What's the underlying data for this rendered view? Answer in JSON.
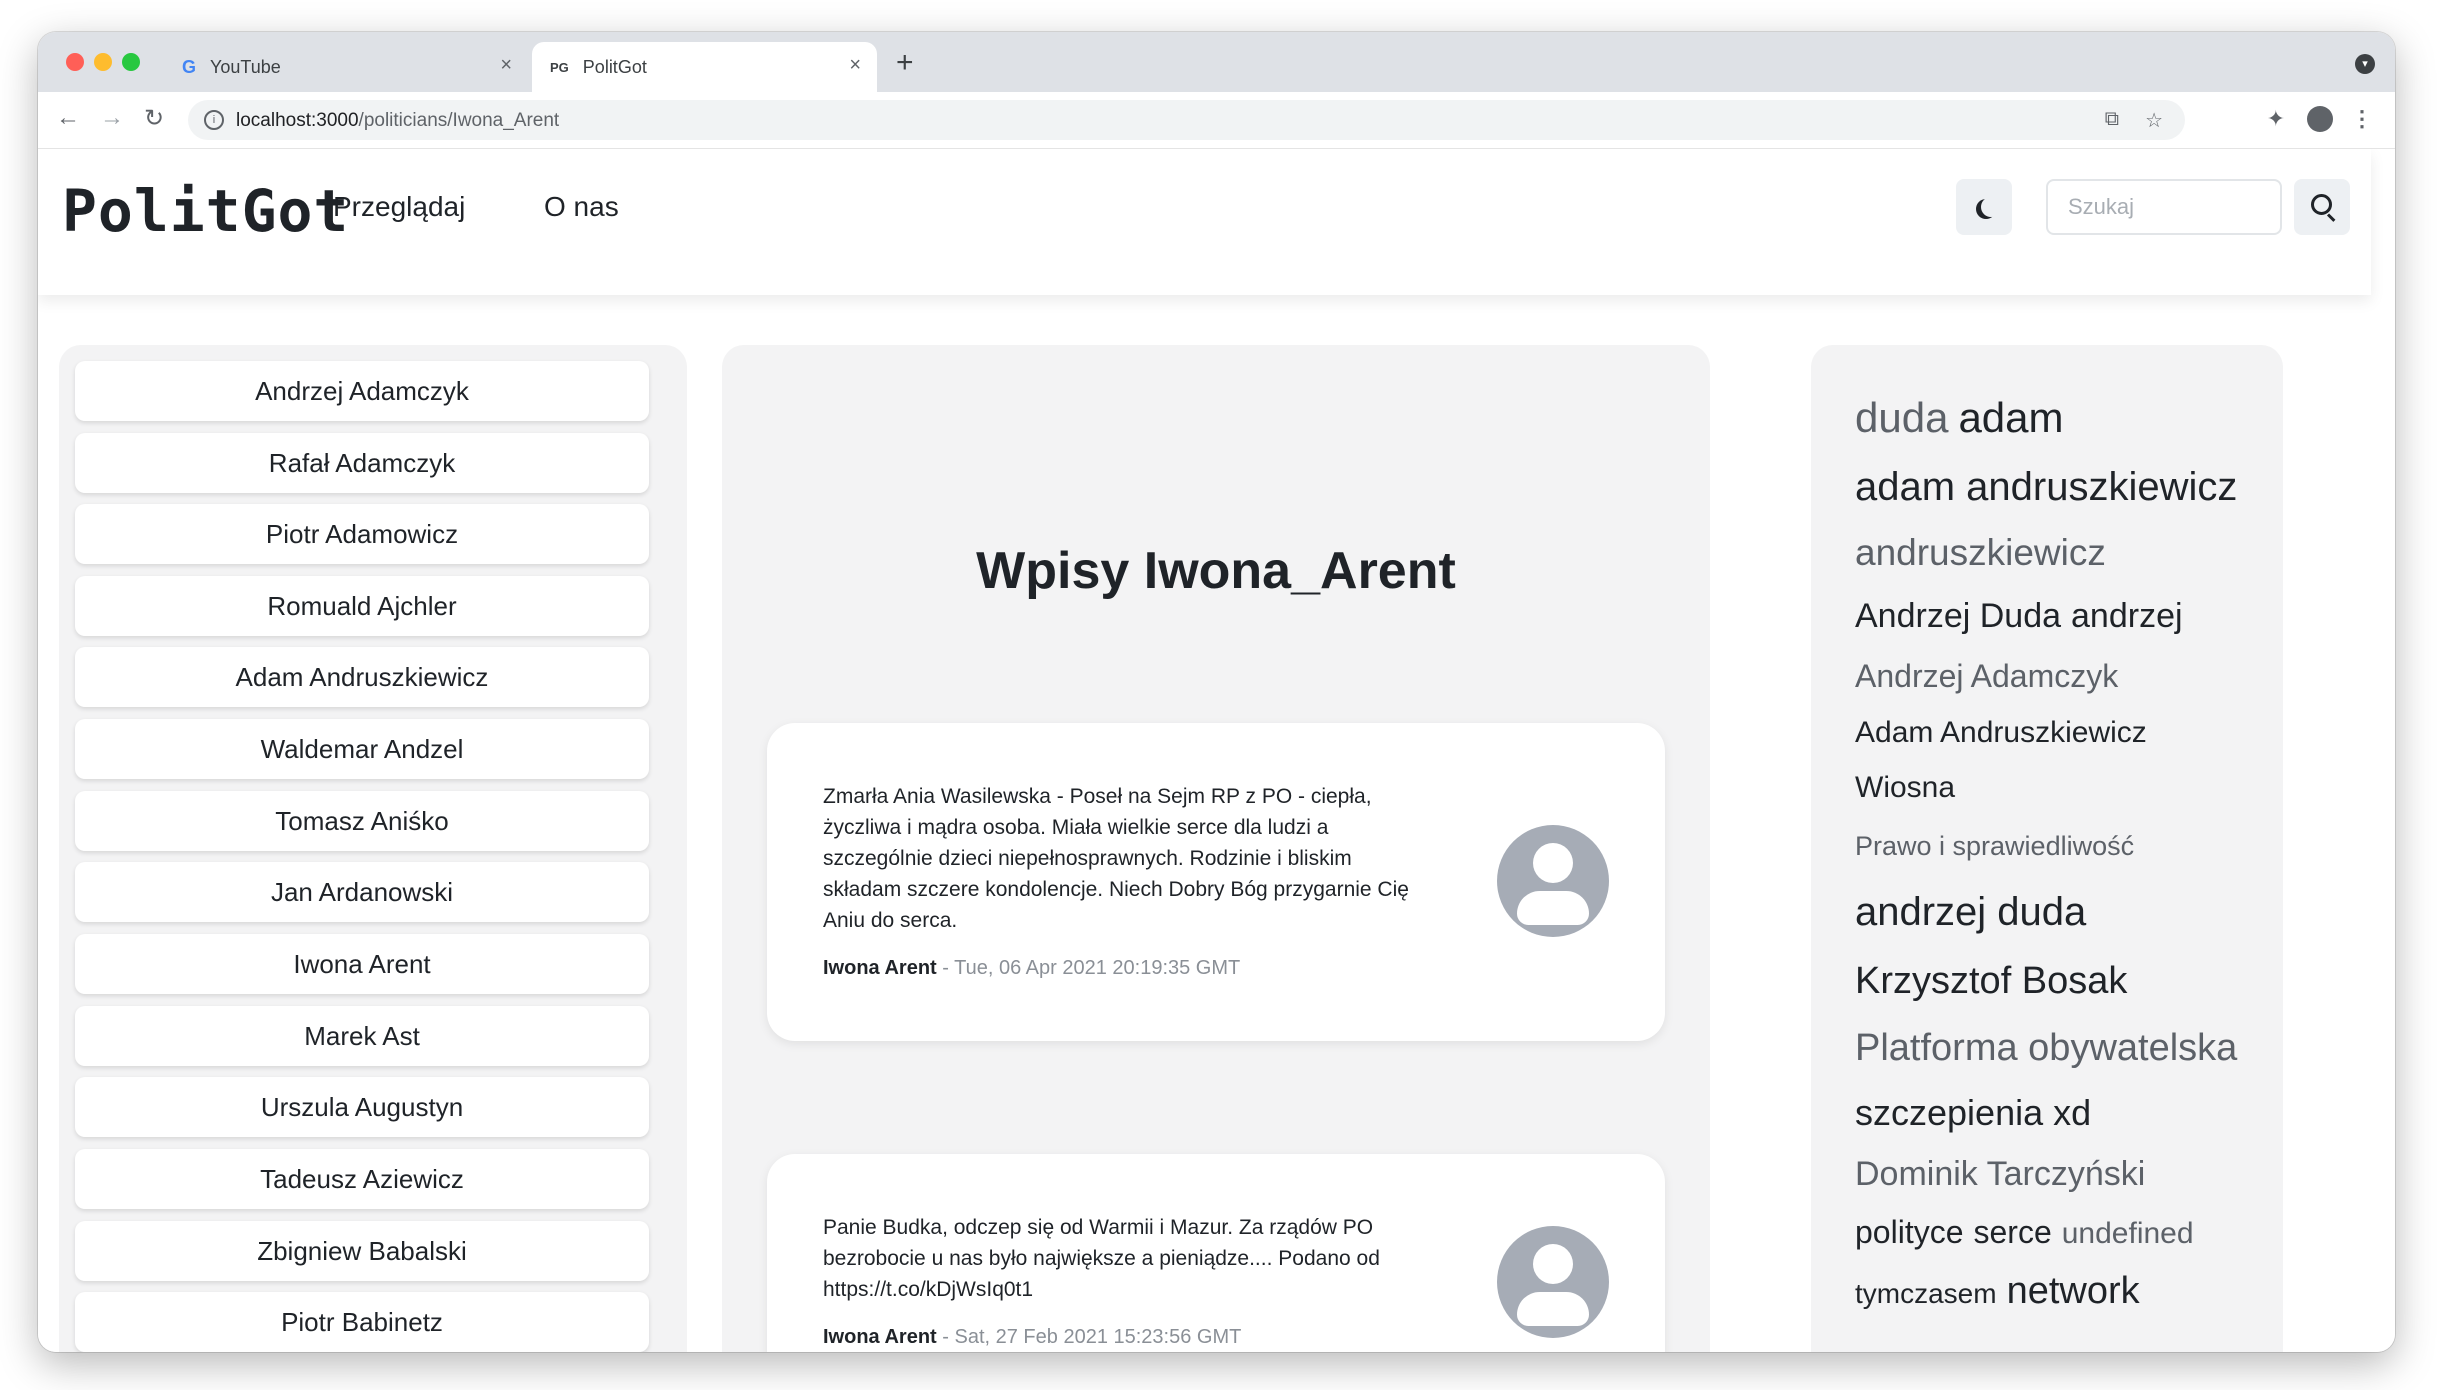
{
  "browser": {
    "tabs": [
      {
        "favicon": "G",
        "title": "YouTube",
        "close": "×"
      },
      {
        "favicon": "PG",
        "title": "PolitGot",
        "close": "×"
      }
    ],
    "new_tab": "+",
    "url_host": "localhost:3000",
    "url_path": "/politicians/Iwona_Arent",
    "icons": [
      "back-icon",
      "forward-icon",
      "reload-icon",
      "translate-icon",
      "star-icon",
      "extensions-icon",
      "profile-icon",
      "menu-icon"
    ]
  },
  "navbar": {
    "brand": "PolitGot",
    "links": [
      "Przeglądaj",
      "O nas"
    ],
    "search_placeholder": "Szukaj"
  },
  "politicians": [
    "Andrzej Adamczyk",
    "Rafał Adamczyk",
    "Piotr Adamowicz",
    "Romuald Ajchler",
    "Adam Andruszkiewicz",
    "Waldemar Andzel",
    "Tomasz Aniśko",
    "Jan Ardanowski",
    "Iwona Arent",
    "Marek Ast",
    "Urszula Augustyn",
    "Tadeusz Aziewicz",
    "Zbigniew Babalski",
    "Piotr Babinetz"
  ],
  "main": {
    "title": "Wpisy Iwona_Arent",
    "posts": [
      {
        "text": "Zmarła Ania Wasilewska - Poseł na Sejm RP z PO - ciepła, życzliwa i mądra osoba. Miała wielkie serce dla ludzi a szczególnie dzieci niepełnosprawnych. Rodzinie i bliskim składam szczere kondolencje. Niech Dobry Bóg przygarnie Cię Aniu do serca.",
        "author": "Iwona Arent",
        "date": "- Tue, 06 Apr 2021 20:19:35 GMT"
      },
      {
        "text": "Panie Budka, odczep się od Warmii i Mazur. Za rządów PO bezrobocie u nas było największe a pieniądze.... Podano od https://t.co/kDjWsIq0t1",
        "author": "Iwona Arent",
        "date": "- Sat, 27 Feb 2021 15:23:56 GMT"
      }
    ]
  },
  "tag_cloud": [
    [
      {
        "text": "duda",
        "weight": 3,
        "size": 42
      },
      {
        "text": "adam",
        "weight": 4,
        "size": 42
      }
    ],
    [
      {
        "text": "adam andruszkiewicz",
        "weight": 4,
        "size": 40
      }
    ],
    [
      {
        "text": "andruszkiewicz",
        "weight": 3,
        "size": 37
      }
    ],
    [
      {
        "text": "Andrzej Duda",
        "weight": 4,
        "size": 34
      },
      {
        "text": "andrzej",
        "weight": 4,
        "size": 34
      }
    ],
    [
      {
        "text": "Andrzej Adamczyk",
        "weight": 3,
        "size": 32
      }
    ],
    [
      {
        "text": "Adam Andruszkiewicz",
        "weight": 4,
        "size": 30
      }
    ],
    [
      {
        "text": "Wiosna",
        "weight": 4,
        "size": 30
      }
    ],
    [
      {
        "text": "Prawo i sprawiedliwość",
        "weight": 3,
        "size": 27
      }
    ],
    [
      {
        "text": "andrzej duda",
        "weight": 4,
        "size": 40
      }
    ],
    [
      {
        "text": "Krzysztof Bosak",
        "weight": 4,
        "size": 38
      }
    ],
    [
      {
        "text": "Platforma obywatelska",
        "weight": 3,
        "size": 38
      }
    ],
    [
      {
        "text": "szczepienia",
        "weight": 4,
        "size": 36
      },
      {
        "text": "xd",
        "weight": 4,
        "size": 36
      }
    ],
    [
      {
        "text": "Dominik Tarczyński",
        "weight": 3,
        "size": 34
      }
    ],
    [
      {
        "text": "polityce",
        "weight": 4,
        "size": 32
      },
      {
        "text": "serce",
        "weight": 4,
        "size": 32
      },
      {
        "text": "undefined",
        "weight": 3,
        "size": 30
      }
    ],
    [
      {
        "text": "tymczasem",
        "weight": 4,
        "size": 28
      },
      {
        "text": "network",
        "weight": 4,
        "size": 38
      }
    ]
  ]
}
